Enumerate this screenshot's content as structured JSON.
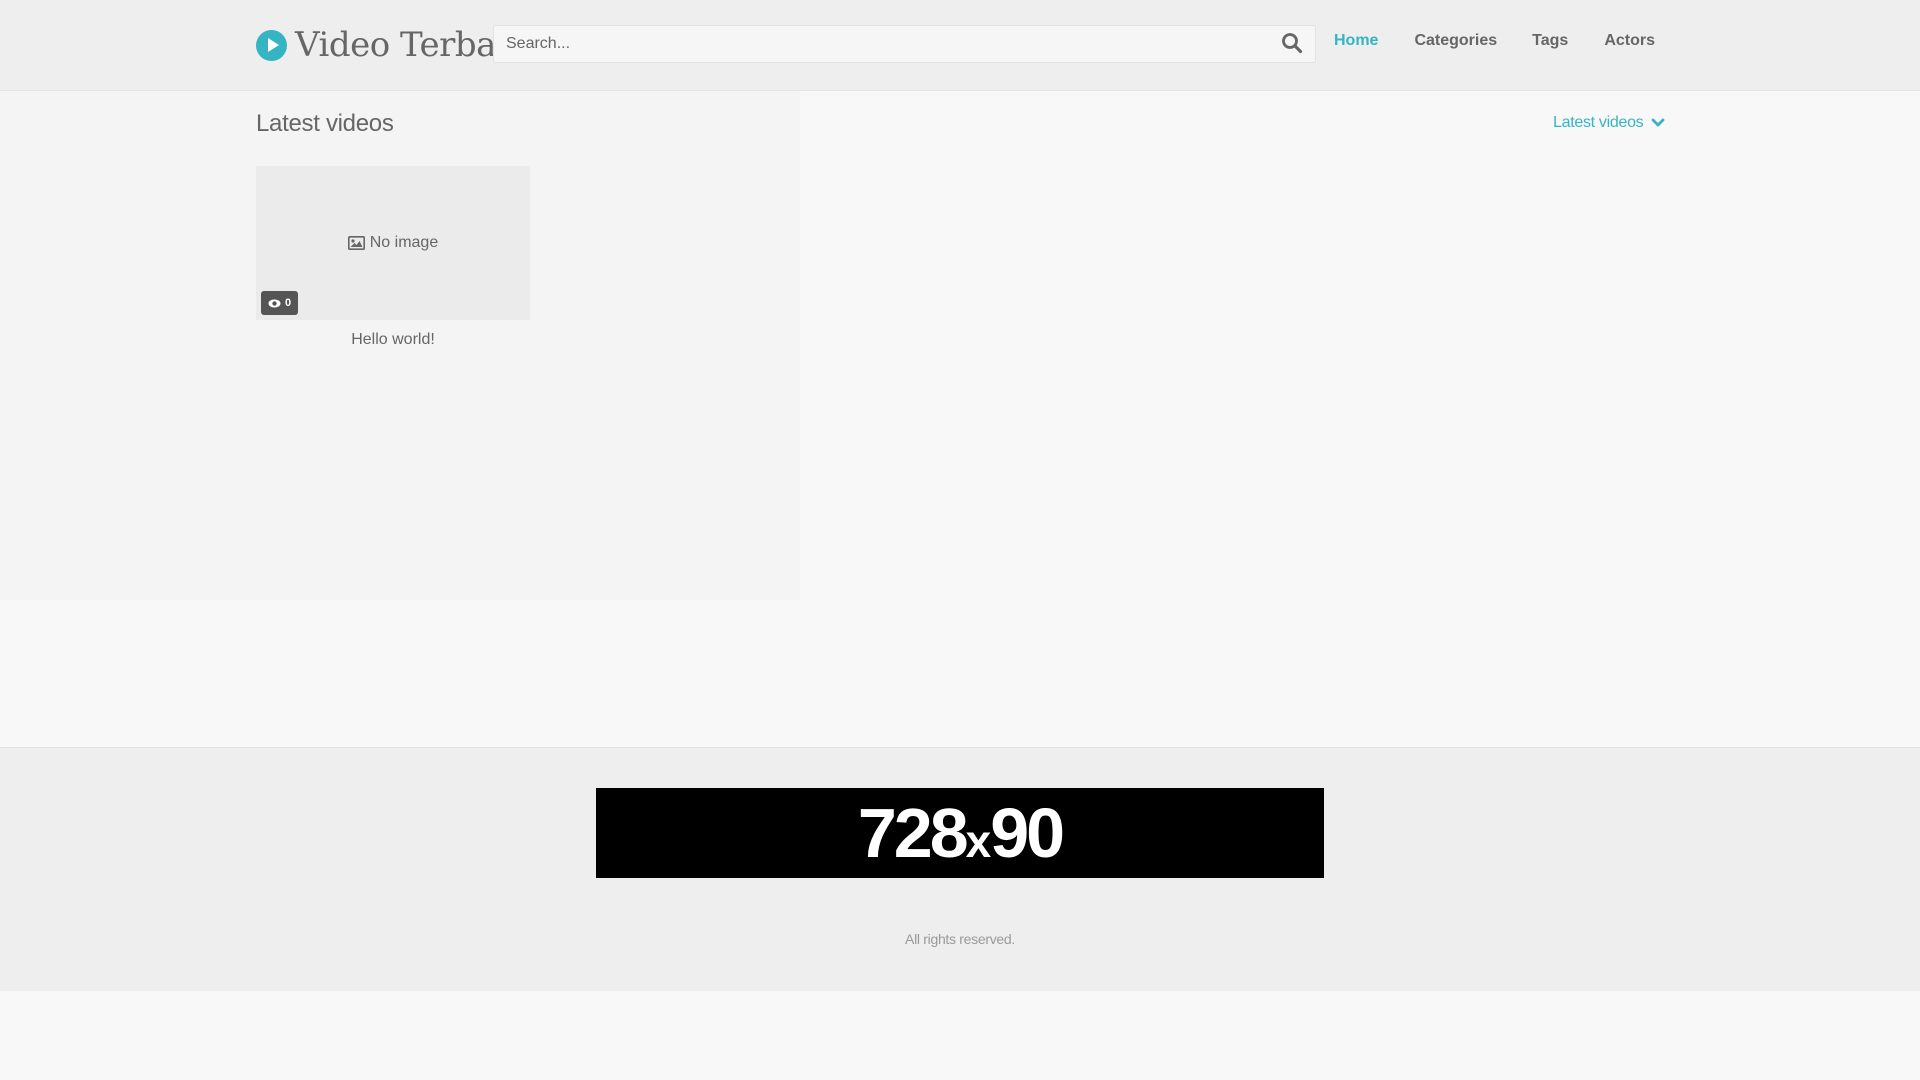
{
  "header": {
    "logo_text": "Video Terbaru",
    "search_placeholder": "Search...",
    "nav": [
      {
        "label": "Home",
        "active": true
      },
      {
        "label": "Categories",
        "active": false
      },
      {
        "label": "Tags",
        "active": false
      },
      {
        "label": "Actors",
        "active": false
      }
    ]
  },
  "main": {
    "title": "Latest videos",
    "sort_label": "Latest videos",
    "videos": [
      {
        "title": "Hello world!",
        "thumbnail_text": "No image",
        "views": "0"
      }
    ]
  },
  "footer": {
    "ad_text_main": "728",
    "ad_text_x": "x",
    "ad_text_end": "90",
    "copyright": "All rights reserved."
  },
  "colors": {
    "accent": "#35b5c3",
    "header_bg": "#eeeeee",
    "page_bg": "#f8f8f8",
    "text": "#666666",
    "ad_bg": "#000000"
  },
  "icons": {
    "logo": "play-circle-icon",
    "search": "search-icon",
    "sort": "chevron-down-icon",
    "thumbnail": "image-icon",
    "views": "eye-icon"
  }
}
